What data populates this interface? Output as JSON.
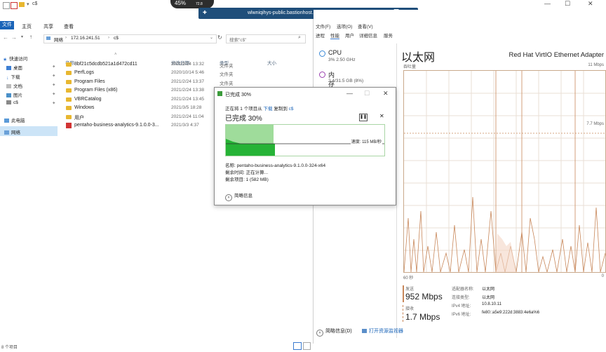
{
  "topbar": {
    "speed_pill": "45%",
    "speed_pill_sub": "72.8",
    "conn_title": "wlwniqihys-public.bastionhost.aliyuncs.com",
    "explorer_title": "c$"
  },
  "explorer": {
    "ribbon_tabs": [
      "文件",
      "主页",
      "共享",
      "查看"
    ],
    "address": [
      "网络",
      "172.16.241.51",
      "c$"
    ],
    "search_placeholder": "搜索\"c$\"",
    "nav": {
      "quick_access": "快速访问",
      "items": [
        "桌面",
        "下载",
        "文档",
        "图片",
        "c$"
      ],
      "this_pc": "此电脑",
      "network": "网络"
    },
    "columns": {
      "name": "名称",
      "date": "修改日期",
      "type": "类型",
      "size": "大小"
    },
    "rows": [
      {
        "name": "8bf21c5dcdb521a1d472cd11",
        "date": "2021/2/24 13:32",
        "type": "文件夹"
      },
      {
        "name": "PerfLogs",
        "date": "2020/10/14 5:46",
        "type": "文件夹"
      },
      {
        "name": "Program Files",
        "date": "2021/2/24 13:37",
        "type": "文件夹"
      },
      {
        "name": "Program Files (x86)",
        "date": "2021/2/24 13:38",
        "type": "文件夹"
      },
      {
        "name": "VBRCatalog",
        "date": "2021/2/24 13:45",
        "type": "文件夹"
      },
      {
        "name": "Windows",
        "date": "2021/3/5 18:28",
        "type": "文件夹"
      },
      {
        "name": "用户",
        "date": "2021/2/24 11:04",
        "type": "文件夹"
      },
      {
        "name": "pentaho-business-analytics-9.1.0.0-3...",
        "date": "2021/3/3 4:37",
        "type": ""
      }
    ],
    "status": "8 个项目"
  },
  "taskmanager": {
    "menu": [
      "文件(F)",
      "选项(O)",
      "查看(V)"
    ],
    "tabs": [
      "进程",
      "性能",
      "用户",
      "详细信息",
      "服务"
    ],
    "cpu": {
      "name": "CPU",
      "sub": "3% 2.50 GHz"
    },
    "memory": {
      "name": "内存",
      "sub": "2.4/31.5 GB (8%)"
    },
    "title": "以太网",
    "adapter": "Red Hat VirtIO Ethernet Adapter",
    "throughput_label": "吞吐量",
    "max_label": "11 Mbps",
    "mid_label": "7.7 Mbps",
    "time_left": "60 秒",
    "time_right": "0",
    "send_label": "发送",
    "send_value": "952 Mbps",
    "recv_label": "接收",
    "recv_value": "1.7 Mbps",
    "adapter_info": [
      {
        "k": "适配器名称:",
        "v": "以太网"
      },
      {
        "k": "连接类型:",
        "v": "以太网"
      },
      {
        "k": "IPv4 地址:",
        "v": "10.8.10.11"
      },
      {
        "k": "IPv6 地址:",
        "v": "fe80::a5e9:222d:3883:4e6a%6"
      }
    ],
    "footer_less": "简略信息(D)",
    "footer_monitor": "打开资源监视器",
    "send_color": "#c8875a"
  },
  "dialog": {
    "title": "已完成 30%",
    "line1_prefix": "正在将 1 个项目从",
    "line1_src": "下载",
    "line1_mid": "复制到",
    "line1_dst": "c$",
    "percent": "已完成 30%",
    "progress": 0.3,
    "speed": "速度: 115 MB/秒",
    "info_name": "名称: pentaho-business-analytics-9.1.0.0-324-x64",
    "info_time": "剩余时间: 正在计算...",
    "info_items": "剩余项目: 1 (582 MB)",
    "less_info": "简略信息",
    "green": "#26b336"
  }
}
